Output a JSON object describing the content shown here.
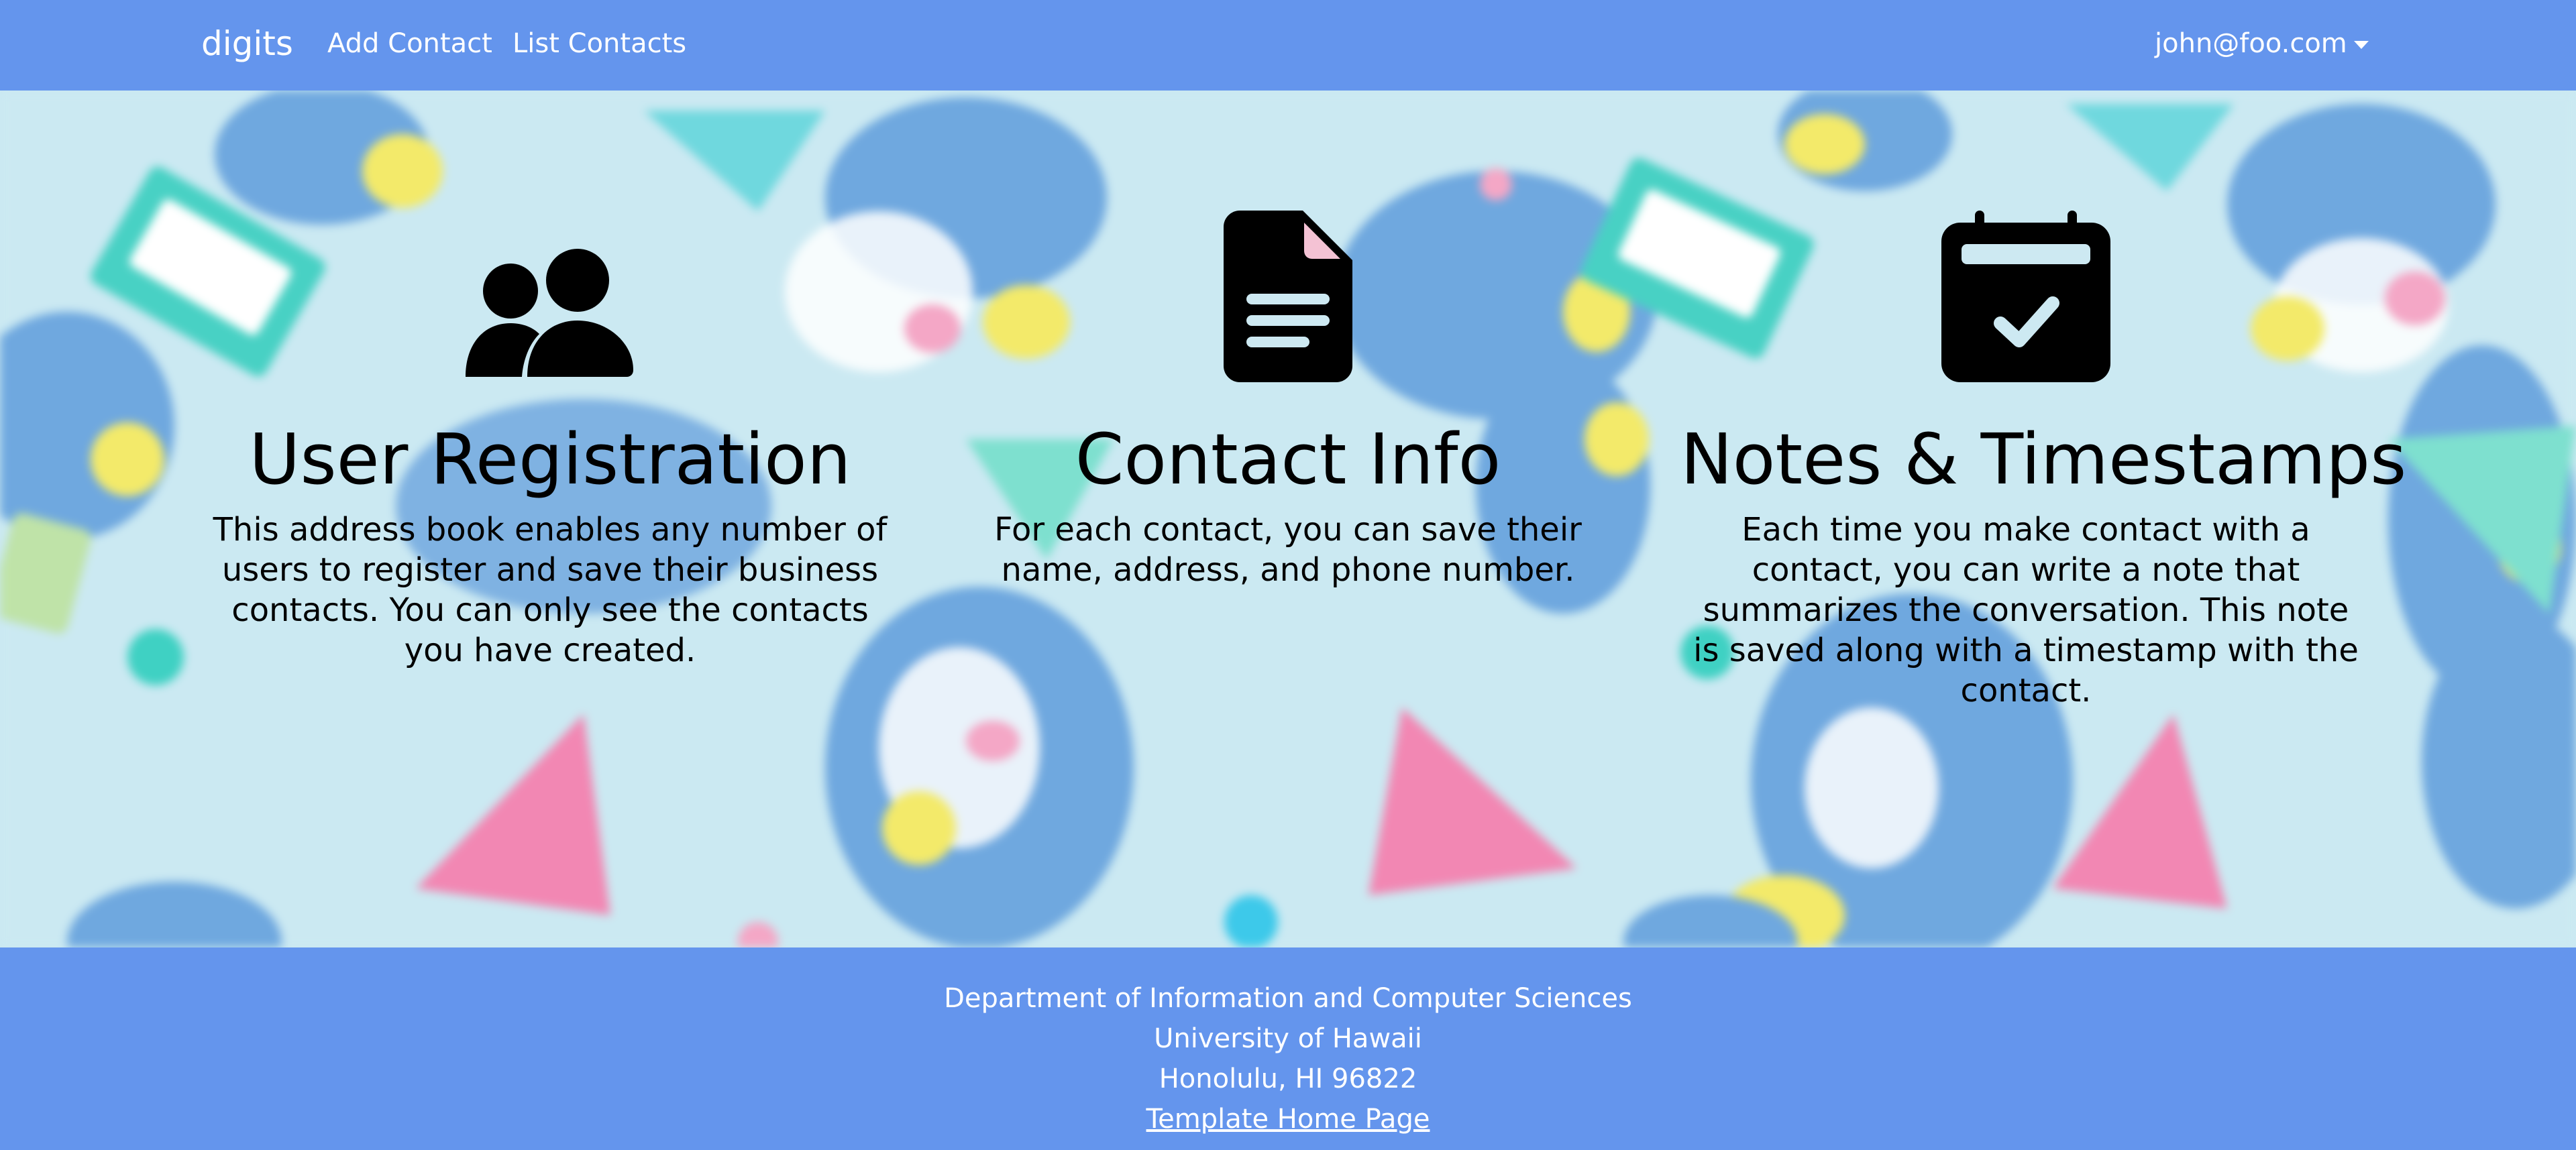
{
  "navbar": {
    "brand": "digits",
    "links": [
      {
        "label": "Add Contact"
      },
      {
        "label": "List Contacts"
      }
    ],
    "user": {
      "email": "john@foo.com"
    }
  },
  "features": [
    {
      "icon": "users-icon",
      "title": "User Registration",
      "text": "This address book enables any number of users to register and save their business contacts. You can only see the contacts you have created."
    },
    {
      "icon": "file-text-icon",
      "title": "Contact Info",
      "text": "For each contact, you can save their name, address, and phone number."
    },
    {
      "icon": "calendar-check-icon",
      "title": "Notes & Timestamps",
      "text": "Each time you make contact with a contact, you can write a note that summarizes the conversation. This note is saved along with a timestamp with the contact."
    }
  ],
  "footer": {
    "lines": [
      "Department of Information and Computer Sciences",
      "University of Hawaii",
      "Honolulu, HI 96822"
    ],
    "link_label": "Template Home Page"
  },
  "colors": {
    "navbar": "#6495ed",
    "footer": "#6495ed",
    "hero_background": "#cbe9f2",
    "text": "#000000"
  }
}
